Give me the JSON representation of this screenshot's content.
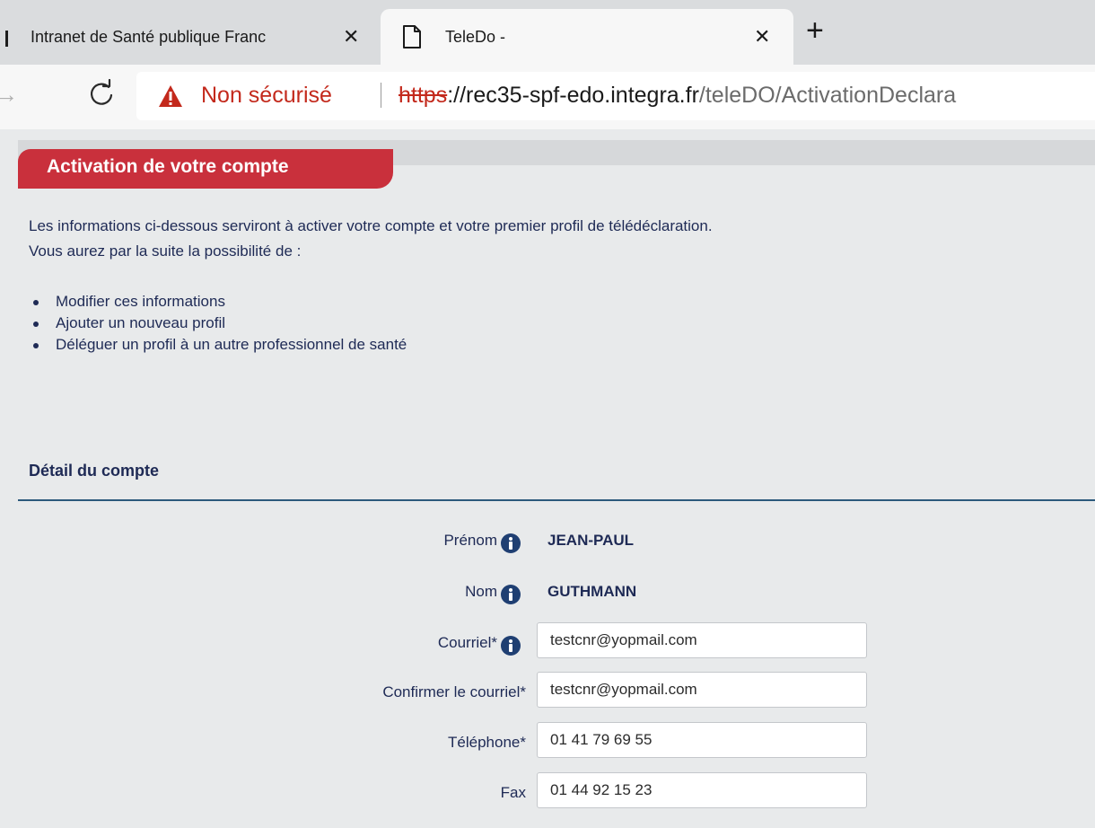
{
  "browser": {
    "tabs": [
      {
        "title": "Intranet de Santé publique Franc",
        "close": "✕"
      },
      {
        "title": "TeleDo -",
        "close": "✕"
      }
    ],
    "new_tab": "+",
    "security_label": "Non sécurisé",
    "url_scheme": "https",
    "url_host": "://rec35-spf-edo.integra.fr",
    "url_path": "/teleDO/ActivationDeclara"
  },
  "page": {
    "section_title": "Activation de votre compte",
    "intro_line1": "Les informations ci-dessous serviront à activer votre compte et votre premier profil de télédéclaration.",
    "intro_line2": "Vous aurez par la suite la possibilité de :",
    "options": [
      "Modifier ces informations",
      "Ajouter un nouveau profil",
      "Déléguer un profil à un autre professionnel de santé"
    ],
    "account_title": "Détail du compte",
    "fields": {
      "prenom": {
        "label": "Prénom",
        "value": "JEAN-PAUL"
      },
      "nom": {
        "label": "Nom",
        "value": "GUTHMANN"
      },
      "courriel": {
        "label": "Courriel*",
        "value": "testcnr@yopmail.com"
      },
      "confirm_courriel": {
        "label": "Confirmer le courriel*",
        "value": "testcnr@yopmail.com"
      },
      "telephone": {
        "label": "Téléphone*",
        "value": "01 41 79 69 55"
      },
      "fax": {
        "label": "Fax",
        "value": "01 44 92 15 23"
      }
    }
  },
  "colors": {
    "accent_red": "#c9303c",
    "text_navy": "#1e2a55",
    "insecure_red": "#c3291c"
  },
  "icons": [
    "doc-icon",
    "close-icon",
    "plus-icon",
    "forward-icon",
    "reload-icon",
    "warning-icon",
    "info-icon"
  ]
}
